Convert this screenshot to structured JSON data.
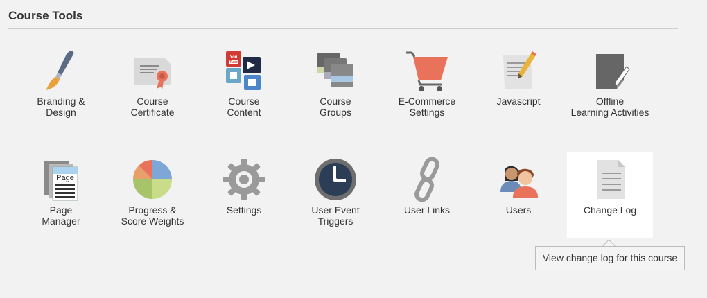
{
  "section": {
    "title": "Course Tools"
  },
  "tools": [
    {
      "label": "Branding &\nDesign",
      "icon": "paintbrush-icon"
    },
    {
      "label": "Course\nCertificate",
      "icon": "certificate-icon"
    },
    {
      "label": "Course\nContent",
      "icon": "course-content-icon"
    },
    {
      "label": "Course\nGroups",
      "icon": "course-groups-icon"
    },
    {
      "label": "E-Commerce\nSettings",
      "icon": "shopping-cart-icon"
    },
    {
      "label": "Javascript",
      "icon": "document-pencil-icon"
    },
    {
      "label": "Offline\nLearning Activities",
      "icon": "notepad-pencil-icon"
    },
    {
      "label": "Page\nManager",
      "icon": "page-stack-icon"
    },
    {
      "label": "Progress &\nScore Weights",
      "icon": "pie-chart-icon"
    },
    {
      "label": "Settings",
      "icon": "gear-icon"
    },
    {
      "label": "User Event\nTriggers",
      "icon": "clock-icon"
    },
    {
      "label": "User Links",
      "icon": "chain-link-icon"
    },
    {
      "label": "Users",
      "icon": "users-icon"
    },
    {
      "label": "Change Log",
      "icon": "document-icon"
    }
  ],
  "tooltip": {
    "text": "View change log for this course"
  },
  "colors": {
    "background": "#f2f2f2",
    "active_tile": "#ffffff",
    "accent_orange": "#e8735a"
  }
}
